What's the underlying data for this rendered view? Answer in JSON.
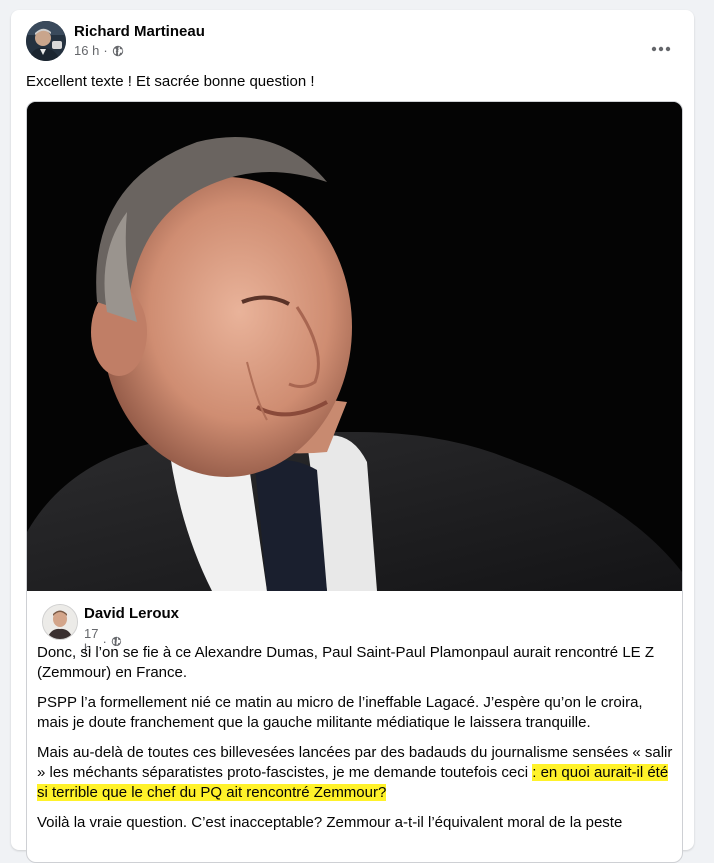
{
  "post": {
    "author": "Richard Martineau",
    "time": "16 h",
    "separator": "·",
    "text": "Excellent texte ! Et sacrée bonne question !",
    "more_icon": "more-horizontal-icon",
    "privacy_icon": "globe-icon"
  },
  "shared": {
    "author": "David Leroux",
    "time": "17 h",
    "separator": "·",
    "paragraphs": [
      "Donc, si l’on se fie à ce Alexandre Dumas, Paul Saint-Paul Plamonpaul aurait rencontré LE Z (Zemmour) en France.",
      "PSPP l’a formellement nié ce matin au micro de l’ineffable Lagacé. J’espère qu’on le croira, mais je doute franchement que la gauche militante médiatique le laissera tranquille."
    ],
    "p3_plain": "Mais au-delà de toutes ces billevesées lancées par des badauds du journalisme sensées « salir » les méchants séparatistes proto-fascistes, je me demande toutefois ceci ",
    "p3_highlight": ": en quoi aurait-il été si terrible que le chef du PQ ait rencontré Zemmour?",
    "p4": "Voilà la vraie question. C’est inacceptable? Zemmour a-t-il l’équivalent moral de la peste"
  },
  "colors": {
    "background": "#f0f2f5",
    "card": "#ffffff",
    "secondary_text": "#65676b",
    "highlight": "#fff22a",
    "border": "#ced0d4"
  }
}
